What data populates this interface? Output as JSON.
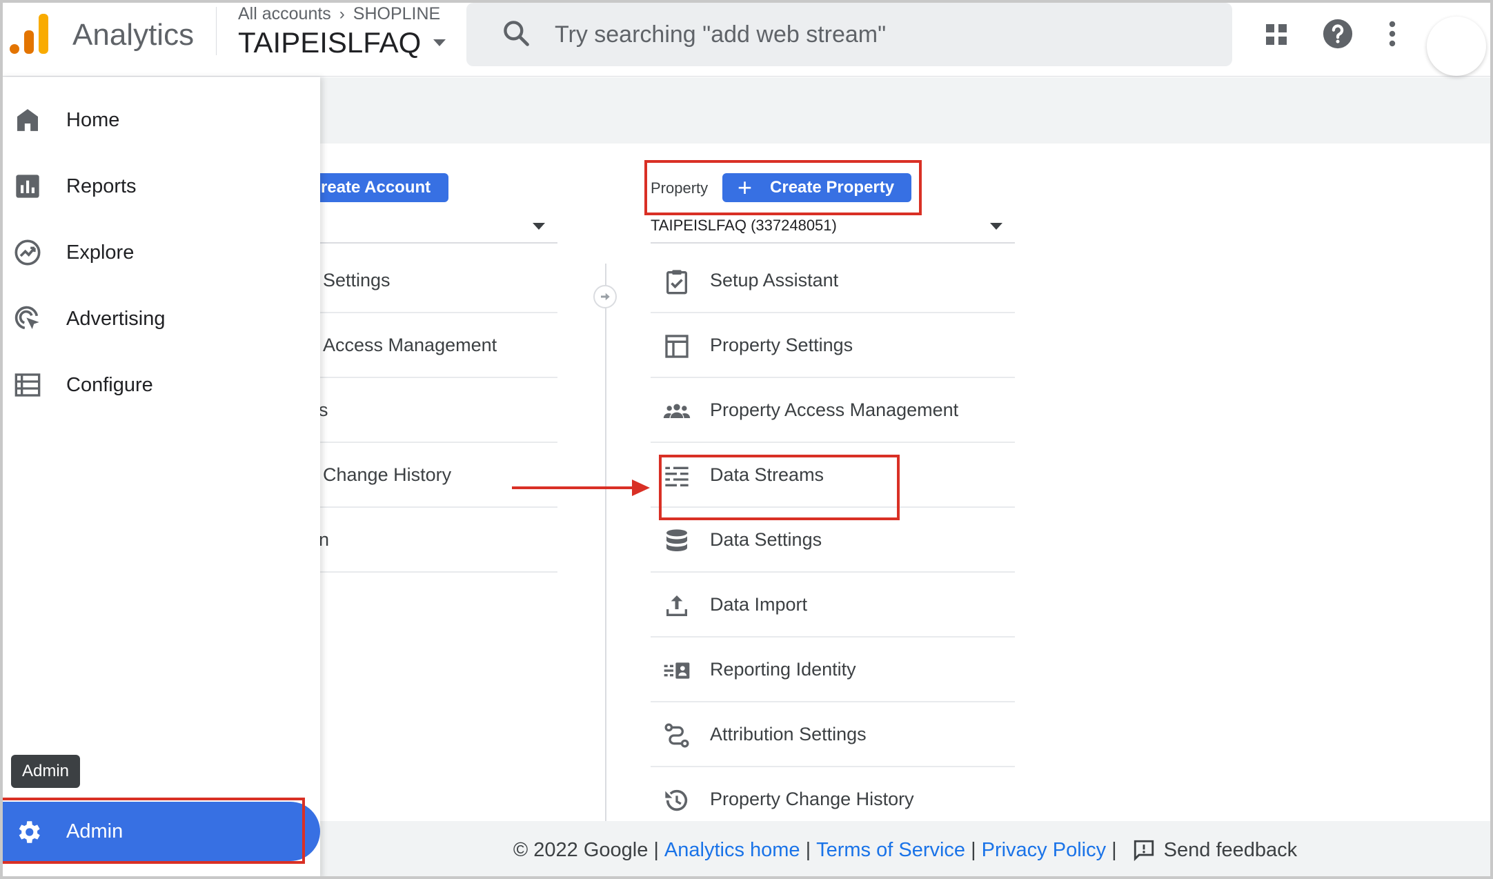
{
  "header": {
    "app_name": "Analytics",
    "breadcrumb_root": "All accounts",
    "breadcrumb_account": "SHOPLINE",
    "property_name": "TAIPEISLFAQ",
    "search_placeholder": "Try searching \"add web stream\""
  },
  "sidebar": {
    "items": [
      {
        "label": "Home",
        "icon": "home-icon"
      },
      {
        "label": "Reports",
        "icon": "reports-icon"
      },
      {
        "label": "Explore",
        "icon": "explore-icon"
      },
      {
        "label": "Advertising",
        "icon": "advertising-icon"
      },
      {
        "label": "Configure",
        "icon": "configure-icon"
      }
    ],
    "admin_label": "Admin",
    "tooltip": "Admin"
  },
  "account_column": {
    "create_button": "reate Account",
    "rows": [
      "Settings",
      "Access Management",
      "s",
      "Change History",
      "n"
    ]
  },
  "property_column": {
    "label": "Property",
    "create_button": "Create Property",
    "selected_property": "TAIPEISLFAQ (337248051)",
    "rows": [
      {
        "label": "Setup Assistant",
        "icon": "clipboard-check-icon"
      },
      {
        "label": "Property Settings",
        "icon": "layout-icon"
      },
      {
        "label": "Property Access Management",
        "icon": "people-icon"
      },
      {
        "label": "Data Streams",
        "icon": "streams-icon"
      },
      {
        "label": "Data Settings",
        "icon": "database-icon"
      },
      {
        "label": "Data Import",
        "icon": "upload-icon"
      },
      {
        "label": "Reporting Identity",
        "icon": "identity-icon"
      },
      {
        "label": "Attribution Settings",
        "icon": "attribution-icon"
      },
      {
        "label": "Property Change History",
        "icon": "history-icon"
      }
    ]
  },
  "footer": {
    "copyright": "© 2022 Google",
    "analytics_home": "Analytics home",
    "terms": "Terms of Service",
    "privacy": "Privacy Policy",
    "feedback": "Send feedback"
  },
  "colors": {
    "brand_blue": "#3770e3",
    "link_blue": "#1a73e8",
    "annotation_red": "#d93025",
    "logo_orange": "#f9ab00",
    "logo_dark_orange": "#e37400"
  }
}
